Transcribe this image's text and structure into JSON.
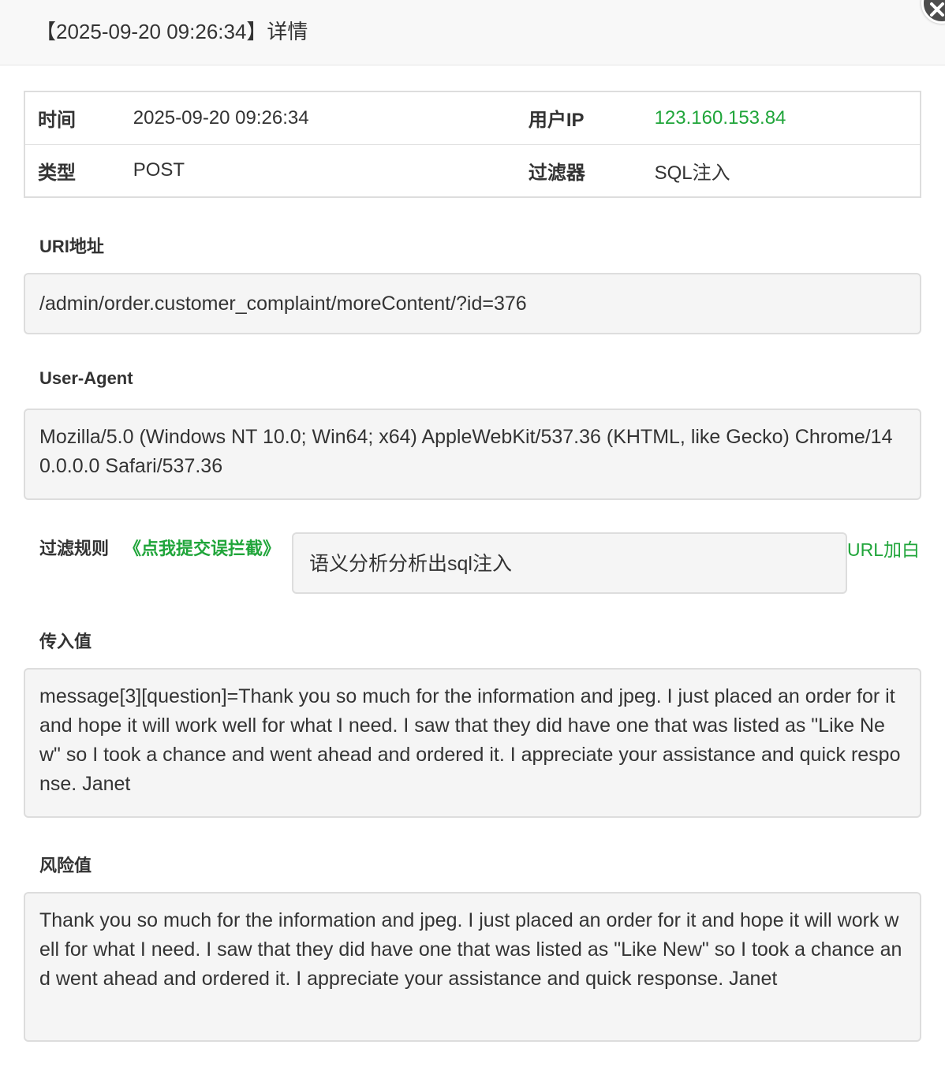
{
  "header": {
    "title": "【2025-09-20 09:26:34】详情"
  },
  "info": {
    "time_label": "时间",
    "time_value": "2025-09-20 09:26:34",
    "ip_label": "用户IP",
    "ip_value": "123.160.153.84",
    "type_label": "类型",
    "type_value": "POST",
    "filter_label": "过滤器",
    "filter_value": "SQL注入"
  },
  "uri": {
    "label": "URI地址",
    "value": "/admin/order.customer_complaint/moreContent/?id=376"
  },
  "user_agent": {
    "label": "User-Agent",
    "value": "Mozilla/5.0 (Windows NT 10.0; Win64; x64) AppleWebKit/537.36 (KHTML, like Gecko) Chrome/140.0.0.0 Safari/537.36"
  },
  "filter_rule": {
    "label": "过滤规则",
    "report_link": "《点我提交误拦截》",
    "value": "语义分析分析出sql注入",
    "url_white_link": "URL加白"
  },
  "input_value": {
    "label": "传入值",
    "value": "message[3][question]=Thank you so much for the information and jpeg. I just placed an order for it and hope it will work well for what I need. I saw that they did have one that was listed as \"Like New\" so I took a chance and went ahead and ordered it. I appreciate your assistance and quick response. Janet"
  },
  "risk_value": {
    "label": "风险值",
    "value": "Thank you so much for the information and jpeg. I just placed an order for it and hope it will work well for what I need. I saw that they did have one that was listed as \"Like New\" so I took a chance and went ahead and ordered it. I appreciate your assistance and quick response. Janet"
  },
  "colors": {
    "accent_green": "#20a53a",
    "box_bg": "#f5f5f5",
    "border": "#dddddd"
  },
  "icons": {
    "close": "close-icon"
  }
}
